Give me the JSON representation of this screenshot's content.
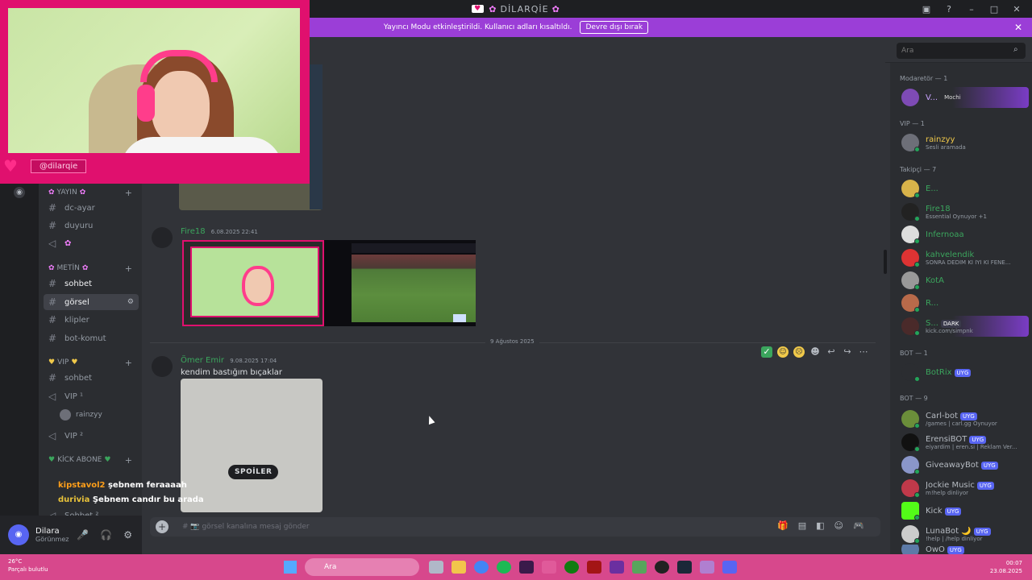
{
  "window": {
    "title": "DİLARQİE",
    "controls": [
      "inbox-icon",
      "help-icon",
      "minimize-icon",
      "maximize-icon",
      "close-icon"
    ]
  },
  "banner": {
    "text": "Yayıncı Modu etkinleştirildi. Kullanıcı adları kısaltıldı.",
    "button": "Devre dışı bırak"
  },
  "stream": {
    "handle": "@dilarqie"
  },
  "search": {
    "placeholder": "Ara"
  },
  "channels": {
    "categories": [
      {
        "label": "YAYIN",
        "channels": [
          "dc-ayar",
          "duyuru",
          ""
        ]
      },
      {
        "label": "METİN",
        "channels": [
          "sohbet",
          "görsel",
          "klipler",
          "bot-komut"
        ]
      },
      {
        "label": "VIP",
        "channels": [
          "sohbet",
          "VIP ¹",
          "VIP ²"
        ],
        "voice_user": "rainzyy"
      },
      {
        "label": "KİCK ABONE",
        "channels": [
          "Sohbet ²"
        ]
      }
    ]
  },
  "overlay_chat": [
    {
      "user": "kipstavol2",
      "message": "şebnem feraaaah"
    },
    {
      "user": "durivia",
      "message": "Şebnem candır bu arada"
    }
  ],
  "user": {
    "name": "Dilara",
    "status": "Görünmez"
  },
  "messages": [
    {
      "author": "Fire18",
      "timestamp": "6.08.2025 22:41",
      "text": ""
    },
    {
      "author": "Ömer Emir",
      "timestamp": "9.08.2025 17:04",
      "text": "kendim bastığım bıçaklar"
    }
  ],
  "date_divider": "9 Ağustos 2025",
  "spoiler_label": "SPOİLER",
  "composer": {
    "placeholder": "# 📷 görsel kanalına mesaj gönder"
  },
  "members": {
    "groups": [
      {
        "label": "Modaretör — 1",
        "items": [
          {
            "name": "V...",
            "sub": "Mochi"
          }
        ]
      },
      {
        "label": "VIP — 1",
        "items": [
          {
            "name": "rainzyy",
            "sub": "Sesli aramada"
          }
        ]
      },
      {
        "label": "Takipçi — 7",
        "items": [
          {
            "name": "E...",
            "sub": ""
          },
          {
            "name": "Fire18",
            "sub": "Essential Oynuyor +1"
          },
          {
            "name": "Infernoaa",
            "sub": ""
          },
          {
            "name": "kahvelendik",
            "sub": "SONRA DEDİM Kİ İYİ Kİ FENE..."
          },
          {
            "name": "KotA",
            "sub": ""
          },
          {
            "name": "R...",
            "sub": ""
          },
          {
            "name": "S...",
            "sub": "kick.com/simpnk",
            "tag": "DARK"
          }
        ]
      },
      {
        "label": "BOT — 1",
        "items": [
          {
            "name": "BotRix",
            "sub": "",
            "tag": "UYG"
          }
        ]
      },
      {
        "label": "BOT — 9",
        "items": [
          {
            "name": "Carl-bot",
            "sub": "/games | carl.gg Oynuyor",
            "tag": "UYG"
          },
          {
            "name": "ErensiBOT",
            "sub": "eiyardim | eren.si | Reklam Ver...",
            "tag": "UYG"
          },
          {
            "name": "GiveawayBot",
            "sub": "",
            "tag": "UYG"
          },
          {
            "name": "Jockie Music",
            "sub": "m!help dinliyor",
            "tag": "UYG"
          },
          {
            "name": "Kick",
            "sub": "",
            "tag": "UYG"
          },
          {
            "name": "LunaBot 🌙",
            "sub": "!help | /help dinliyor",
            "tag": "UYG"
          },
          {
            "name": "OwO",
            "sub": "",
            "tag": "UYG"
          }
        ]
      }
    ]
  },
  "taskbar": {
    "weather_temp": "26°C",
    "weather_desc": "Parçalı bulutlu",
    "search": "Ara",
    "time": "00:07",
    "date": "23.08.2025"
  },
  "colors": {
    "accent_pink": "#e0106e",
    "banner_purple": "#9b3ed7",
    "online_green": "#23a55a",
    "bot_tag": "#5865f2"
  }
}
